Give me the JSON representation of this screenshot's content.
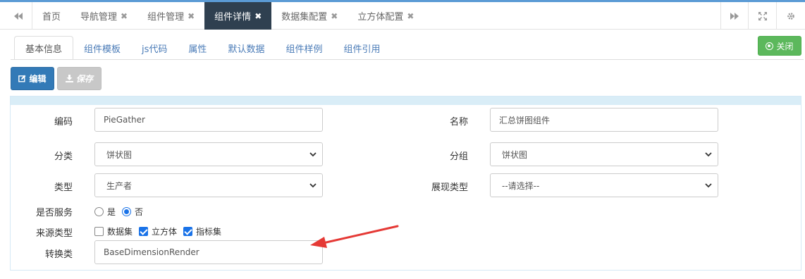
{
  "top_tabs": [
    {
      "label": "首页",
      "closable": false
    },
    {
      "label": "导航管理",
      "closable": true
    },
    {
      "label": "组件管理",
      "closable": true
    },
    {
      "label": "组件详情",
      "closable": true,
      "active": true
    },
    {
      "label": "数据集配置",
      "closable": true
    },
    {
      "label": "立方体配置",
      "closable": true
    }
  ],
  "close_glyph": "✖",
  "sub_tabs": [
    "基本信息",
    "组件模板",
    "js代码",
    "属性",
    "默认数据",
    "组件样例",
    "组件引用"
  ],
  "toolbar": {
    "close_label": "关闭",
    "edit_label": "编辑",
    "save_label": "保存"
  },
  "form": {
    "code": {
      "label": "编码",
      "value": "PieGather"
    },
    "name": {
      "label": "名称",
      "value": "汇总饼图组件"
    },
    "category": {
      "label": "分类",
      "value": "饼状图"
    },
    "group": {
      "label": "分组",
      "value": "饼状图"
    },
    "type": {
      "label": "类型",
      "value": "生产者"
    },
    "display_type": {
      "label": "展现类型",
      "value": "--请选择--"
    },
    "is_service": {
      "label": "是否服务",
      "options": [
        "是",
        "否"
      ],
      "selected": "否"
    },
    "source_type": {
      "label": "来源类型",
      "options": [
        {
          "label": "数据集",
          "checked": false
        },
        {
          "label": "立方体",
          "checked": true
        },
        {
          "label": "指标集",
          "checked": true
        }
      ]
    },
    "converter": {
      "label": "转换类",
      "value": "BaseDimensionRender"
    }
  },
  "colors": {
    "accent": "#337ab7",
    "active_tab_bg": "#2f4050",
    "close_button": "#5cb85c",
    "annotation_arrow": "#e53935"
  },
  "icons": {
    "nav_left": "double-left-icon",
    "nav_right": "double-right-icon",
    "fullscreen": "fullscreen-icon",
    "settings": "gear-icon",
    "close": "close-circle-icon",
    "edit": "edit-icon",
    "save": "download-icon"
  }
}
